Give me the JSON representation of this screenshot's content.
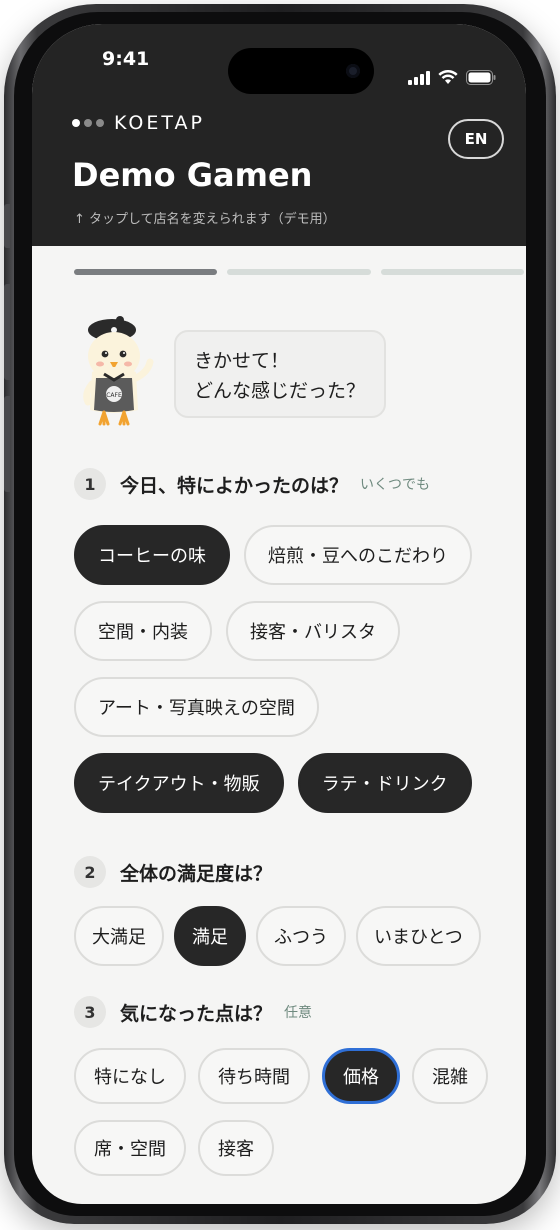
{
  "status_bar": {
    "time": "9:41"
  },
  "header": {
    "brand": "KOETAP",
    "lang_button": "EN",
    "store_name": "Demo Gamen",
    "store_hint": "↑ タップして店名を変えられます（デモ用）"
  },
  "progress": {
    "total_steps": 3,
    "current_step": 1
  },
  "mascot": {
    "badge_text": "CAFE"
  },
  "bubble": {
    "line1": "きかせて！",
    "line2": "どんな感じだった？"
  },
  "questions": [
    {
      "num": "1",
      "title": "今日、特によかったのは？",
      "note": "いくつでも",
      "options": [
        {
          "label": "コーヒーの味",
          "selected": true
        },
        {
          "label": "焙煎・豆へのこだわり",
          "selected": false
        },
        {
          "label": "空間・内装",
          "selected": false
        },
        {
          "label": "接客・バリスタ",
          "selected": false
        },
        {
          "label": "アート・写真映えの空間",
          "selected": false
        },
        {
          "label": "テイクアウト・物販",
          "selected": true
        },
        {
          "label": "ラテ・ドリンク",
          "selected": true
        }
      ]
    },
    {
      "num": "2",
      "title": "全体の満足度は？",
      "note": "",
      "options": [
        {
          "label": "大満足",
          "selected": false
        },
        {
          "label": "満足",
          "selected": true
        },
        {
          "label": "ふつう",
          "selected": false
        },
        {
          "label": "いまひとつ",
          "selected": false
        }
      ]
    },
    {
      "num": "3",
      "title": "気になった点は？",
      "note": "任意",
      "options": [
        {
          "label": "特になし",
          "selected": false
        },
        {
          "label": "待ち時間",
          "selected": false
        },
        {
          "label": "価格",
          "selected": true
        },
        {
          "label": "混雑",
          "selected": false
        },
        {
          "label": "席・空間",
          "selected": false
        },
        {
          "label": "接客",
          "selected": false
        }
      ]
    }
  ],
  "colors": {
    "header_bg": "#242424",
    "selected_chip": "#272727",
    "focus_ring": "#2f6fd6",
    "note_green": "#6f8a7f"
  }
}
